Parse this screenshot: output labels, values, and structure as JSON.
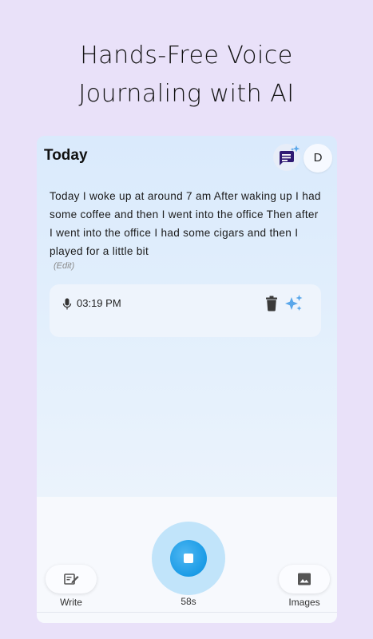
{
  "headline": {
    "line1": "Hands-Free Voice",
    "line2": "Journaling with AI"
  },
  "header": {
    "title": "Today",
    "avatar_initial": "D",
    "ai_chat_icon": "chat-sparkle-icon"
  },
  "entry": {
    "text": "Today I woke up at around 7 am After waking up I had some coffee and then I went into the office Then after I went into the office I had some cigars and then I played for a little bit",
    "edit_label": "(Edit)"
  },
  "recording": {
    "time": "03:19 PM",
    "icons": [
      "mic-icon",
      "trash-icon",
      "sparkle-icon"
    ]
  },
  "bottom_bar": {
    "write_label": "Write",
    "images_label": "Images",
    "timer": "58s"
  },
  "colors": {
    "background": "#e9e1f9",
    "accent_blue": "#1a9be6",
    "chat_icon": "#2f1a73",
    "sparkle": "#5aa7ea"
  }
}
